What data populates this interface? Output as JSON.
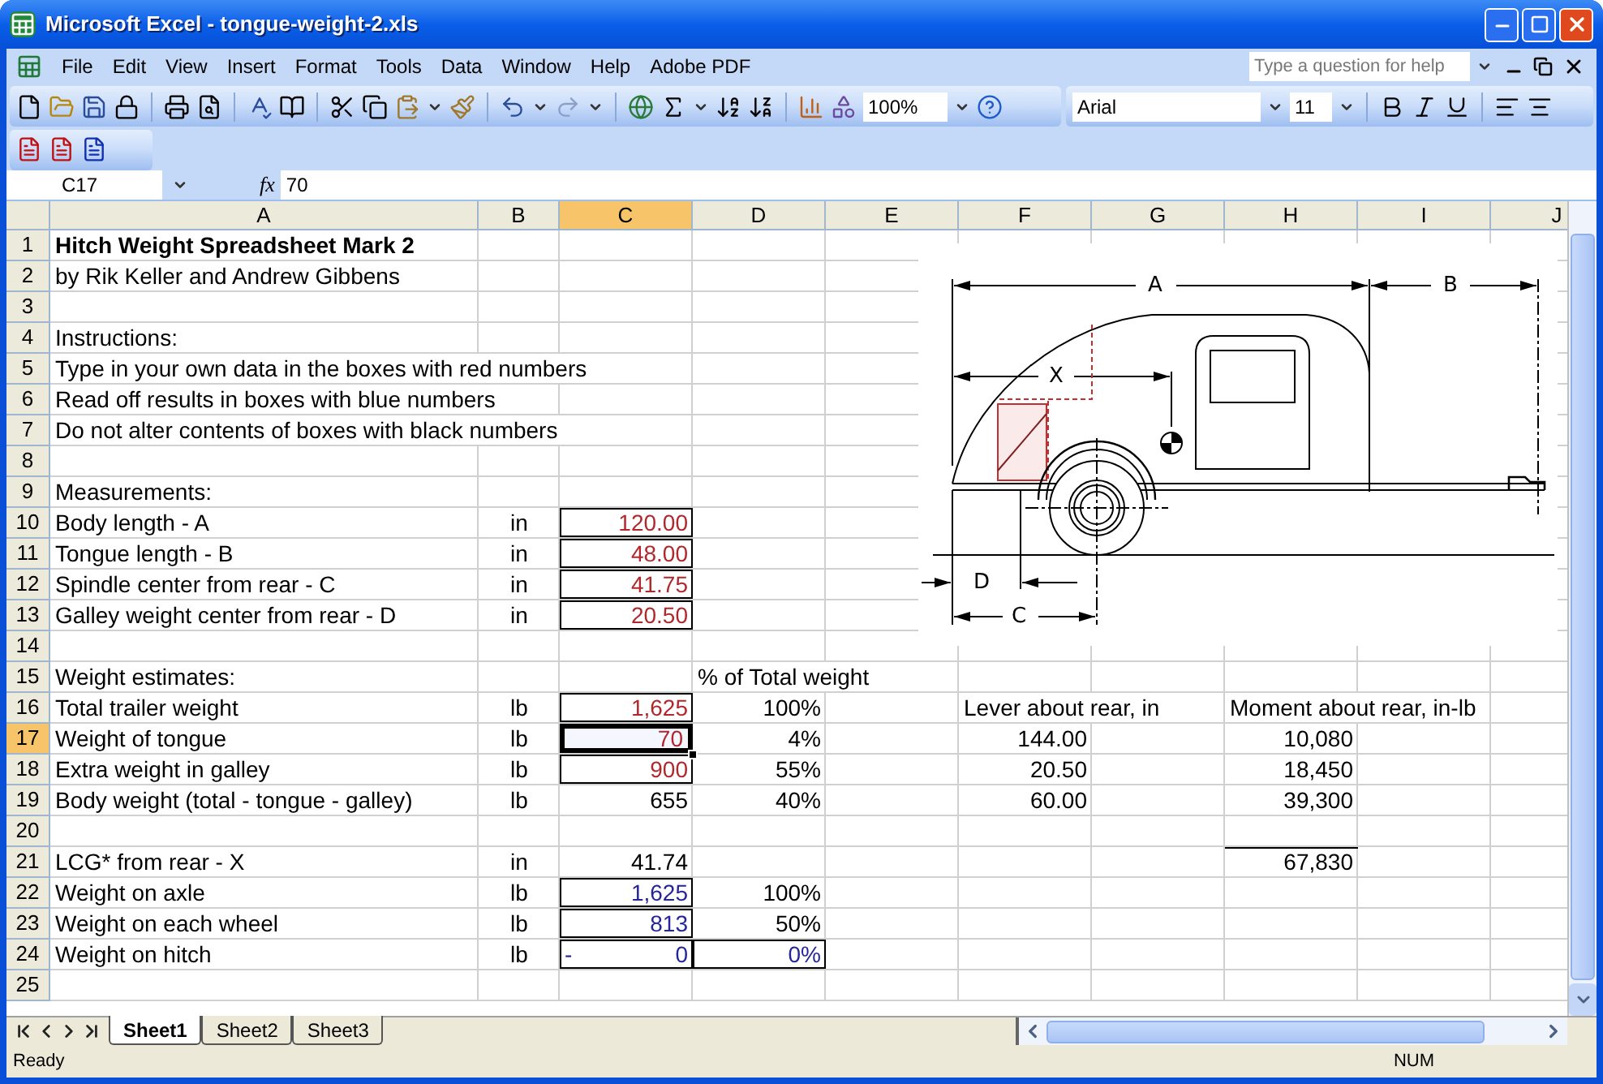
{
  "window": {
    "title": "Microsoft Excel - tongue-weight-2.xls"
  },
  "menu": [
    "File",
    "Edit",
    "View",
    "Insert",
    "Format",
    "Tools",
    "Data",
    "Window",
    "Help",
    "Adobe PDF"
  ],
  "help_search": {
    "placeholder": "Type a question for help"
  },
  "standard_toolbar": {
    "zoom": "100%"
  },
  "formatting_toolbar": {
    "font": "Arial",
    "size": "11"
  },
  "formula_bar": {
    "name_box": "C17",
    "function_label": "fx",
    "value": "70"
  },
  "columns": [
    {
      "label": "A",
      "selected": false
    },
    {
      "label": "B",
      "selected": false
    },
    {
      "label": "C",
      "selected": true
    },
    {
      "label": "D",
      "selected": false
    },
    {
      "label": "E",
      "selected": false
    },
    {
      "label": "F",
      "selected": false
    },
    {
      "label": "G",
      "selected": false
    },
    {
      "label": "H",
      "selected": false
    },
    {
      "label": "I",
      "selected": false
    },
    {
      "label": "J",
      "selected": false
    }
  ],
  "rows": [
    {
      "number": "1",
      "selected": false,
      "label": "Hitch Weight Spreadsheet Mark 2",
      "bold": true
    },
    {
      "number": "2",
      "selected": false,
      "label": "by Rik Keller and Andrew Gibbens",
      "bold": false
    },
    {
      "number": "3",
      "selected": false
    },
    {
      "number": "4",
      "selected": false,
      "label": "Instructions:",
      "bold": false
    },
    {
      "number": "5",
      "selected": false,
      "label": "Type in your own data in the boxes with red numbers",
      "bold": false
    },
    {
      "number": "6",
      "selected": false,
      "label": "Read off results in boxes with blue numbers",
      "bold": false
    },
    {
      "number": "7",
      "selected": false,
      "label": "Do not alter contents of boxes with black numbers",
      "bold": false
    },
    {
      "number": "8",
      "selected": false
    },
    {
      "number": "9",
      "selected": false,
      "label": "Measurements:",
      "bold": false
    },
    {
      "number": "10",
      "selected": false,
      "label": "Body length - A",
      "bold": false,
      "unit": "in",
      "value": {
        "text": "120.00",
        "kind": "input",
        "boxed": true,
        "selected": false
      }
    },
    {
      "number": "11",
      "selected": false,
      "label": "Tongue length - B",
      "bold": false,
      "unit": "in",
      "value": {
        "text": "48.00",
        "kind": "input",
        "boxed": true,
        "selected": false
      }
    },
    {
      "number": "12",
      "selected": false,
      "label": "Spindle center from rear - C",
      "bold": false,
      "unit": "in",
      "value": {
        "text": "41.75",
        "kind": "input",
        "boxed": true,
        "selected": false
      }
    },
    {
      "number": "13",
      "selected": false,
      "label": "Galley weight center from rear - D",
      "bold": false,
      "unit": "in",
      "value": {
        "text": "20.50",
        "kind": "input",
        "boxed": true,
        "selected": false
      }
    },
    {
      "number": "14",
      "selected": false
    },
    {
      "number": "15",
      "selected": false,
      "label": "Weight estimates:",
      "bold": false,
      "percent": {
        "text": "% of Total weight",
        "kind": "heading",
        "boxed": false
      }
    },
    {
      "number": "16",
      "selected": false,
      "label": "Total trailer weight",
      "bold": false,
      "unit": "lb",
      "value": {
        "text": "1,625",
        "kind": "input",
        "boxed": true,
        "selected": false
      },
      "percent": {
        "text": "100%",
        "kind": "plain",
        "boxed": false
      },
      "lever": {
        "text": "Lever about rear, in",
        "kind": "heading"
      },
      "moment": {
        "text": "Moment about rear, in-lb",
        "kind": "heading",
        "total": false
      }
    },
    {
      "number": "17",
      "selected": true,
      "label": "Weight of tongue",
      "bold": false,
      "unit": "lb",
      "value": {
        "text": "70",
        "kind": "input",
        "boxed": true,
        "selected": true
      },
      "percent": {
        "text": "4%",
        "kind": "plain",
        "boxed": false
      },
      "lever": {
        "text": "144.00",
        "kind": "plain"
      },
      "moment": {
        "text": "10,080",
        "kind": "plain",
        "total": false
      }
    },
    {
      "number": "18",
      "selected": false,
      "label": "Extra weight in galley",
      "bold": false,
      "unit": "lb",
      "value": {
        "text": "900",
        "kind": "input",
        "boxed": true,
        "selected": false
      },
      "percent": {
        "text": "55%",
        "kind": "plain",
        "boxed": false
      },
      "lever": {
        "text": "20.50",
        "kind": "plain"
      },
      "moment": {
        "text": "18,450",
        "kind": "plain",
        "total": false
      }
    },
    {
      "number": "19",
      "selected": false,
      "label": "Body weight (total - tongue - galley)",
      "bold": false,
      "unit": "lb",
      "value": {
        "text": "655",
        "kind": "plain",
        "boxed": false,
        "selected": false
      },
      "percent": {
        "text": "40%",
        "kind": "plain",
        "boxed": false
      },
      "lever": {
        "text": "60.00",
        "kind": "plain"
      },
      "moment": {
        "text": "39,300",
        "kind": "plain",
        "total": false
      }
    },
    {
      "number": "20",
      "selected": false
    },
    {
      "number": "21",
      "selected": false,
      "label": "LCG* from rear - X",
      "bold": false,
      "unit": "in",
      "value": {
        "text": "41.74",
        "kind": "plain",
        "boxed": false,
        "selected": false
      },
      "moment": {
        "text": "67,830",
        "kind": "plain",
        "total": true
      }
    },
    {
      "number": "22",
      "selected": false,
      "label": "Weight on axle",
      "bold": false,
      "unit": "lb",
      "value": {
        "text": "1,625",
        "kind": "output",
        "boxed": true,
        "selected": false
      },
      "percent": {
        "text": "100%",
        "kind": "plain",
        "boxed": false
      }
    },
    {
      "number": "23",
      "selected": false,
      "label": "Weight on each wheel",
      "bold": false,
      "unit": "lb",
      "value": {
        "text": "813",
        "kind": "output",
        "boxed": true,
        "selected": false
      },
      "percent": {
        "text": "50%",
        "kind": "plain",
        "boxed": false
      }
    },
    {
      "number": "24",
      "selected": false,
      "label": "Weight on hitch",
      "bold": false,
      "unit": "lb",
      "value": {
        "text": "0",
        "sign": "-",
        "kind": "output",
        "boxed": true,
        "selected": false
      },
      "percent": {
        "text": "0%",
        "kind": "output",
        "boxed": true
      }
    },
    {
      "number": "25",
      "selected": false
    }
  ],
  "diagram": {
    "labels": [
      "A",
      "B",
      "X",
      "D",
      "C"
    ]
  },
  "sheet_tabs": [
    {
      "label": "Sheet1",
      "selected": true
    },
    {
      "label": "Sheet2",
      "selected": false
    },
    {
      "label": "Sheet3",
      "selected": false
    }
  ],
  "status_bar": {
    "status": "Ready",
    "indicator": "NUM"
  }
}
